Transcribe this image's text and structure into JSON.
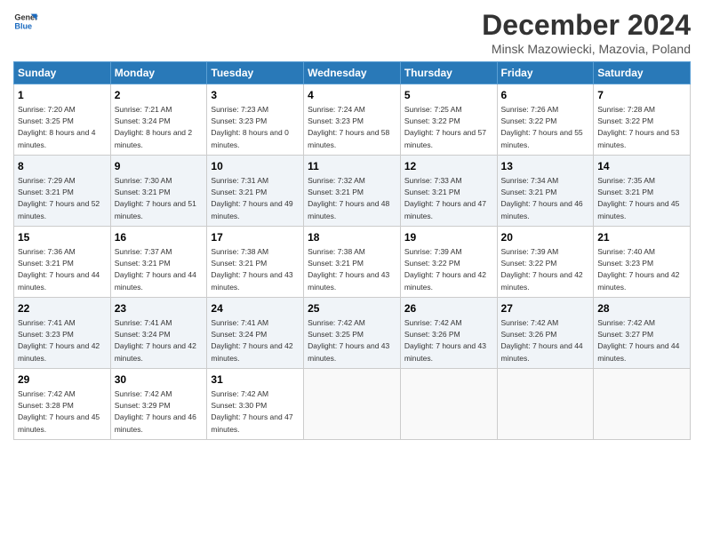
{
  "header": {
    "logo_line1": "General",
    "logo_line2": "Blue",
    "title": "December 2024",
    "subtitle": "Minsk Mazowiecki, Mazovia, Poland"
  },
  "days_of_week": [
    "Sunday",
    "Monday",
    "Tuesday",
    "Wednesday",
    "Thursday",
    "Friday",
    "Saturday"
  ],
  "weeks": [
    [
      {
        "day": "1",
        "rise": "Sunrise: 7:20 AM",
        "set": "Sunset: 3:25 PM",
        "daylight": "Daylight: 8 hours and 4 minutes."
      },
      {
        "day": "2",
        "rise": "Sunrise: 7:21 AM",
        "set": "Sunset: 3:24 PM",
        "daylight": "Daylight: 8 hours and 2 minutes."
      },
      {
        "day": "3",
        "rise": "Sunrise: 7:23 AM",
        "set": "Sunset: 3:23 PM",
        "daylight": "Daylight: 8 hours and 0 minutes."
      },
      {
        "day": "4",
        "rise": "Sunrise: 7:24 AM",
        "set": "Sunset: 3:23 PM",
        "daylight": "Daylight: 7 hours and 58 minutes."
      },
      {
        "day": "5",
        "rise": "Sunrise: 7:25 AM",
        "set": "Sunset: 3:22 PM",
        "daylight": "Daylight: 7 hours and 57 minutes."
      },
      {
        "day": "6",
        "rise": "Sunrise: 7:26 AM",
        "set": "Sunset: 3:22 PM",
        "daylight": "Daylight: 7 hours and 55 minutes."
      },
      {
        "day": "7",
        "rise": "Sunrise: 7:28 AM",
        "set": "Sunset: 3:22 PM",
        "daylight": "Daylight: 7 hours and 53 minutes."
      }
    ],
    [
      {
        "day": "8",
        "rise": "Sunrise: 7:29 AM",
        "set": "Sunset: 3:21 PM",
        "daylight": "Daylight: 7 hours and 52 minutes."
      },
      {
        "day": "9",
        "rise": "Sunrise: 7:30 AM",
        "set": "Sunset: 3:21 PM",
        "daylight": "Daylight: 7 hours and 51 minutes."
      },
      {
        "day": "10",
        "rise": "Sunrise: 7:31 AM",
        "set": "Sunset: 3:21 PM",
        "daylight": "Daylight: 7 hours and 49 minutes."
      },
      {
        "day": "11",
        "rise": "Sunrise: 7:32 AM",
        "set": "Sunset: 3:21 PM",
        "daylight": "Daylight: 7 hours and 48 minutes."
      },
      {
        "day": "12",
        "rise": "Sunrise: 7:33 AM",
        "set": "Sunset: 3:21 PM",
        "daylight": "Daylight: 7 hours and 47 minutes."
      },
      {
        "day": "13",
        "rise": "Sunrise: 7:34 AM",
        "set": "Sunset: 3:21 PM",
        "daylight": "Daylight: 7 hours and 46 minutes."
      },
      {
        "day": "14",
        "rise": "Sunrise: 7:35 AM",
        "set": "Sunset: 3:21 PM",
        "daylight": "Daylight: 7 hours and 45 minutes."
      }
    ],
    [
      {
        "day": "15",
        "rise": "Sunrise: 7:36 AM",
        "set": "Sunset: 3:21 PM",
        "daylight": "Daylight: 7 hours and 44 minutes."
      },
      {
        "day": "16",
        "rise": "Sunrise: 7:37 AM",
        "set": "Sunset: 3:21 PM",
        "daylight": "Daylight: 7 hours and 44 minutes."
      },
      {
        "day": "17",
        "rise": "Sunrise: 7:38 AM",
        "set": "Sunset: 3:21 PM",
        "daylight": "Daylight: 7 hours and 43 minutes."
      },
      {
        "day": "18",
        "rise": "Sunrise: 7:38 AM",
        "set": "Sunset: 3:21 PM",
        "daylight": "Daylight: 7 hours and 43 minutes."
      },
      {
        "day": "19",
        "rise": "Sunrise: 7:39 AM",
        "set": "Sunset: 3:22 PM",
        "daylight": "Daylight: 7 hours and 42 minutes."
      },
      {
        "day": "20",
        "rise": "Sunrise: 7:39 AM",
        "set": "Sunset: 3:22 PM",
        "daylight": "Daylight: 7 hours and 42 minutes."
      },
      {
        "day": "21",
        "rise": "Sunrise: 7:40 AM",
        "set": "Sunset: 3:23 PM",
        "daylight": "Daylight: 7 hours and 42 minutes."
      }
    ],
    [
      {
        "day": "22",
        "rise": "Sunrise: 7:41 AM",
        "set": "Sunset: 3:23 PM",
        "daylight": "Daylight: 7 hours and 42 minutes."
      },
      {
        "day": "23",
        "rise": "Sunrise: 7:41 AM",
        "set": "Sunset: 3:24 PM",
        "daylight": "Daylight: 7 hours and 42 minutes."
      },
      {
        "day": "24",
        "rise": "Sunrise: 7:41 AM",
        "set": "Sunset: 3:24 PM",
        "daylight": "Daylight: 7 hours and 42 minutes."
      },
      {
        "day": "25",
        "rise": "Sunrise: 7:42 AM",
        "set": "Sunset: 3:25 PM",
        "daylight": "Daylight: 7 hours and 43 minutes."
      },
      {
        "day": "26",
        "rise": "Sunrise: 7:42 AM",
        "set": "Sunset: 3:26 PM",
        "daylight": "Daylight: 7 hours and 43 minutes."
      },
      {
        "day": "27",
        "rise": "Sunrise: 7:42 AM",
        "set": "Sunset: 3:26 PM",
        "daylight": "Daylight: 7 hours and 44 minutes."
      },
      {
        "day": "28",
        "rise": "Sunrise: 7:42 AM",
        "set": "Sunset: 3:27 PM",
        "daylight": "Daylight: 7 hours and 44 minutes."
      }
    ],
    [
      {
        "day": "29",
        "rise": "Sunrise: 7:42 AM",
        "set": "Sunset: 3:28 PM",
        "daylight": "Daylight: 7 hours and 45 minutes."
      },
      {
        "day": "30",
        "rise": "Sunrise: 7:42 AM",
        "set": "Sunset: 3:29 PM",
        "daylight": "Daylight: 7 hours and 46 minutes."
      },
      {
        "day": "31",
        "rise": "Sunrise: 7:42 AM",
        "set": "Sunset: 3:30 PM",
        "daylight": "Daylight: 7 hours and 47 minutes."
      },
      null,
      null,
      null,
      null
    ]
  ]
}
